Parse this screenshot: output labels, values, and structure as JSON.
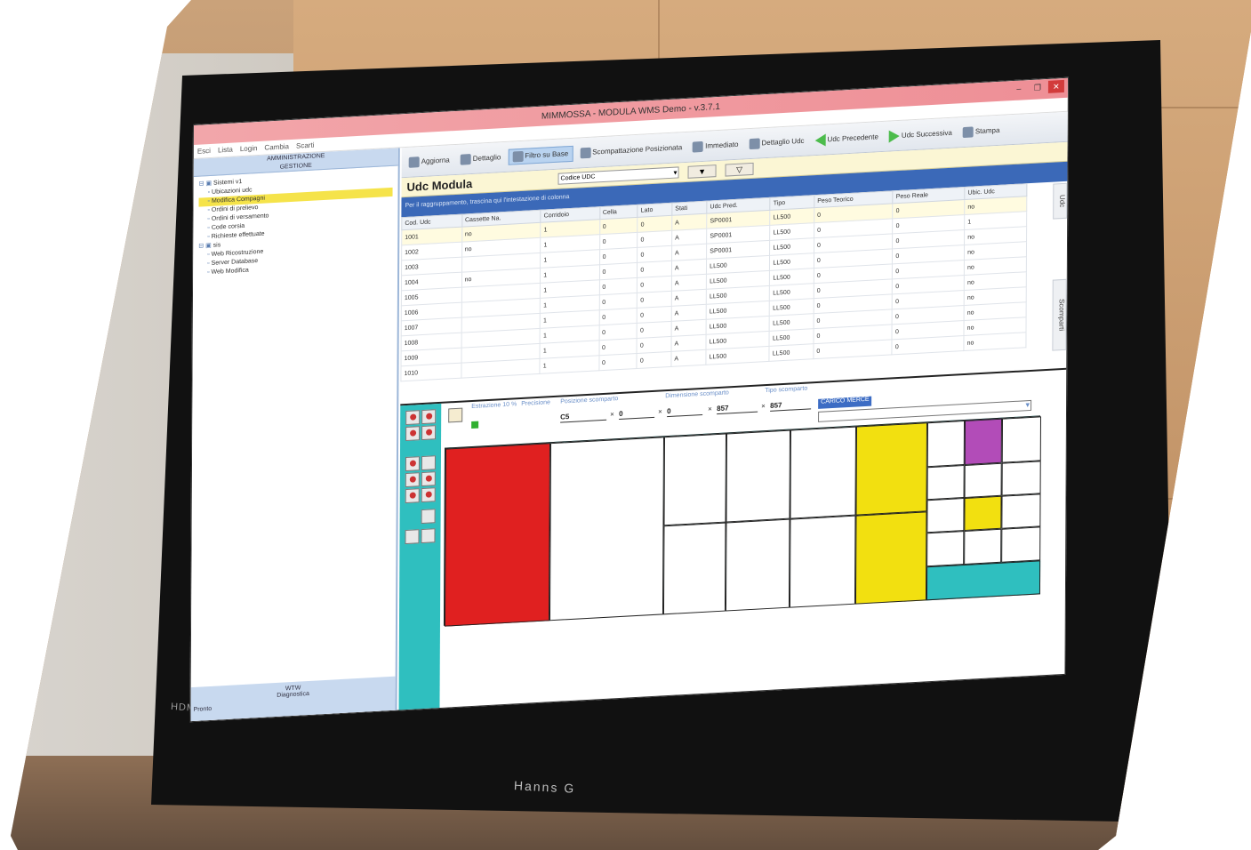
{
  "window": {
    "title": "MIMMOSSA - MODULA WMS Demo - v.3.7.1"
  },
  "menubar": {
    "items": [
      "Esci",
      "Lista",
      "Login",
      "Cambia",
      "Scarti"
    ]
  },
  "left_panel": {
    "header_line1": "AMMINISTRAZIONE",
    "header_line2": "GESTIONE",
    "tree": [
      {
        "label": "Sistemi v1",
        "level": 0,
        "selected": false
      },
      {
        "label": "Ubicazioni udc",
        "level": 1,
        "selected": false
      },
      {
        "label": "Modifica Compagni",
        "level": 1,
        "selected": true
      },
      {
        "label": "Ordini di prelievo",
        "level": 1,
        "selected": false
      },
      {
        "label": "Ordini di versamento",
        "level": 1,
        "selected": false
      },
      {
        "label": "Code corsia",
        "level": 1,
        "selected": false
      },
      {
        "label": "Richieste effettuate",
        "level": 1,
        "selected": false
      },
      {
        "label": "sis",
        "level": 0,
        "selected": false
      },
      {
        "label": "Web Ricostruzione",
        "level": 1,
        "selected": false
      },
      {
        "label": "Server Database",
        "level": 1,
        "selected": false
      },
      {
        "label": "Web Modifica",
        "level": 1,
        "selected": false
      }
    ],
    "footer_line1": "WTW",
    "footer_line2": "Diagnostica",
    "footer_status": "Pronto"
  },
  "toolbar": {
    "buttons": [
      {
        "label": "Aggiorna",
        "active": false
      },
      {
        "label": "Dettaglio",
        "active": false
      },
      {
        "label": "Filtro su Base",
        "active": true
      },
      {
        "label": "Scompattazione Posizionata",
        "active": false
      },
      {
        "label": "Immediato",
        "active": false
      },
      {
        "label": "Dettaglio Udc",
        "active": false
      },
      {
        "label": "Udc Precedente",
        "active": false
      },
      {
        "label": "Udc Successiva",
        "active": false
      },
      {
        "label": "Stampa",
        "active": false
      }
    ]
  },
  "form": {
    "title": "Udc Modula",
    "select_value": "Codice UDC",
    "filter1": "▼",
    "filter2": "▽"
  },
  "infobar": {
    "text": "Per il raggruppamento, trascina qui l'intestazione di colonna"
  },
  "grid": {
    "columns": [
      "Cod. Udc",
      "Cassette Na.",
      "Corridoio",
      "Cella",
      "Lato",
      "Stati",
      "Udc Pred.",
      "Tipo",
      "Peso Teorico",
      "Peso Reale",
      "Ubic. Udc"
    ],
    "rows": [
      [
        "1001",
        "no",
        "1",
        "0",
        "0",
        "A",
        "SP0001",
        "LL500",
        "0",
        "0",
        "no"
      ],
      [
        "1002",
        "no",
        "1",
        "0",
        "0",
        "A",
        "SP0001",
        "LL500",
        "0",
        "0",
        "1"
      ],
      [
        "1003",
        "",
        "1",
        "0",
        "0",
        "A",
        "SP0001",
        "LL500",
        "0",
        "0",
        "no"
      ],
      [
        "1004",
        "no",
        "1",
        "0",
        "0",
        "A",
        "LL500",
        "LL500",
        "0",
        "0",
        "no"
      ],
      [
        "1005",
        "",
        "1",
        "0",
        "0",
        "A",
        "LL500",
        "LL500",
        "0",
        "0",
        "no"
      ],
      [
        "1006",
        "",
        "1",
        "0",
        "0",
        "A",
        "LL500",
        "LL500",
        "0",
        "0",
        "no"
      ],
      [
        "1007",
        "",
        "1",
        "0",
        "0",
        "A",
        "LL500",
        "LL500",
        "0",
        "0",
        "no"
      ],
      [
        "1008",
        "",
        "1",
        "0",
        "0",
        "A",
        "LL500",
        "LL500",
        "0",
        "0",
        "no"
      ],
      [
        "1009",
        "",
        "1",
        "0",
        "0",
        "A",
        "LL500",
        "LL500",
        "0",
        "0",
        "no"
      ],
      [
        "1010",
        "",
        "1",
        "0",
        "0",
        "A",
        "LL500",
        "LL500",
        "0",
        "0",
        "no"
      ]
    ],
    "side_tab_top": "Udc",
    "side_tab_bottom": "Scomparti"
  },
  "layout_editor": {
    "labels": [
      "Estrazione 10 %",
      "Precisione",
      "Posizione scomparto",
      "Dimensione scomparto",
      "Tipo scomparto"
    ],
    "values": {
      "precision": "C5",
      "pos_x": "0",
      "pos_y": "0",
      "dim_x": "857",
      "dim_y": "857",
      "tipo": "CARICO MERCE"
    },
    "cell_colors": {
      "red": "#e02020",
      "yellow": "#f2e010",
      "magenta": "#b24cb8",
      "teal": "#2fbfbf",
      "white": "#ffffff"
    }
  },
  "monitor": {
    "brand_bezel": "HDMI",
    "brand_logo": "Hanns G"
  }
}
